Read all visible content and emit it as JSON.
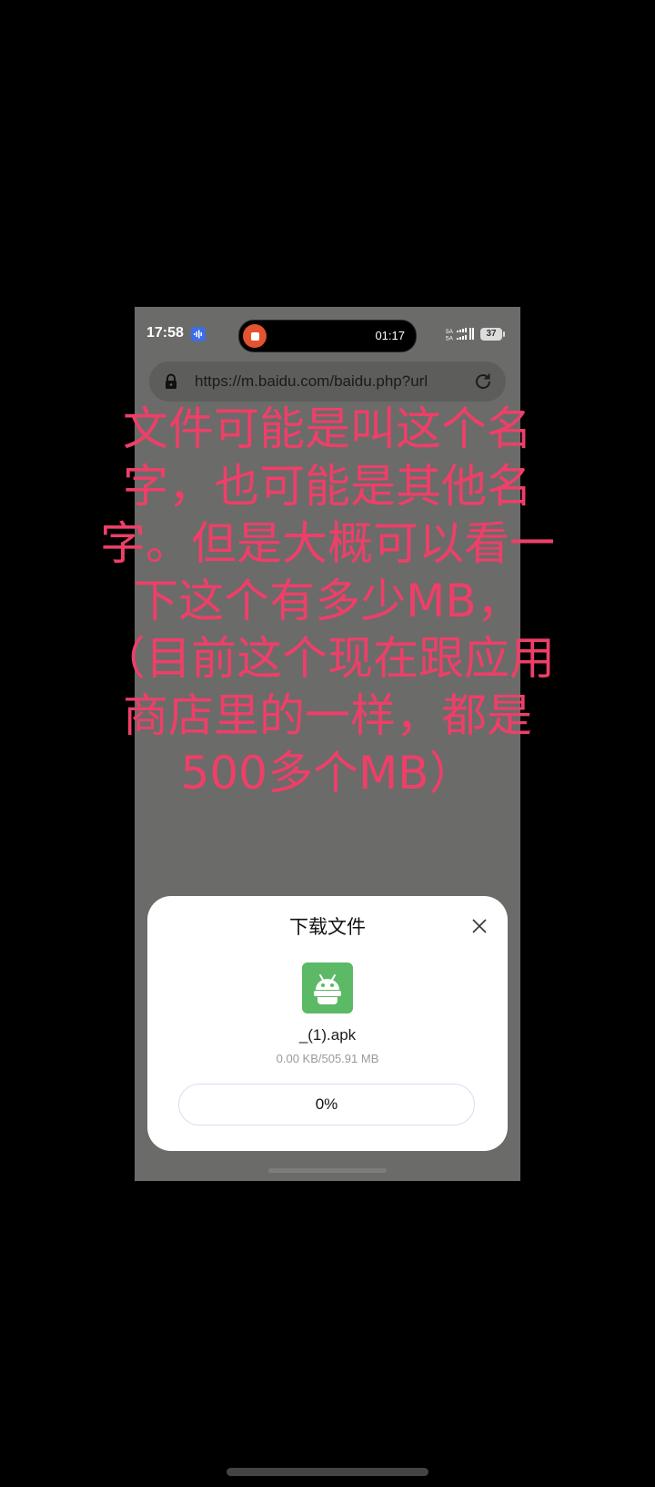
{
  "status_bar": {
    "time": "17:58",
    "record_timer": "01:17",
    "signal_text": "5A 5A",
    "battery": "37"
  },
  "browser": {
    "url": "https://m.baidu.com/baidu.php?url"
  },
  "annotation": {
    "lines": [
      "文件可能是叫这个名",
      "字，也可能是其他名",
      "字。但是大概可以看一",
      "下这个有多少MB，",
      "（目前这个现在跟应用",
      "商店里的一样，都是",
      "500多个MB）"
    ]
  },
  "download_dialog": {
    "title": "下载文件",
    "file_name": "_(1).apk",
    "file_size": "0.00 KB/505.91 MB",
    "progress_label": "0%",
    "progress_fraction": 0
  },
  "colors": {
    "annotation": "#ee3f69",
    "app_icon": "#5cb965",
    "record_button": "#e4532f",
    "voice_badge": "#3d6ee8"
  },
  "icons": {
    "lock": "lock-icon",
    "reload": "reload-icon",
    "close": "close-icon",
    "app": "android-icon",
    "voice": "voice-icon",
    "stop": "stop-icon"
  }
}
